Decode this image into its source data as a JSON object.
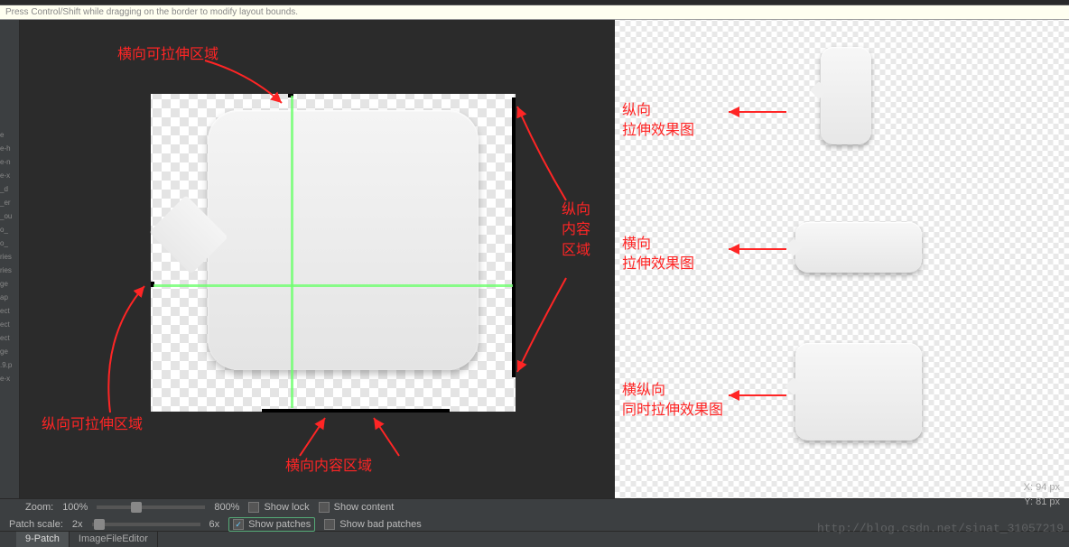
{
  "hint": "Press Control/Shift while dragging on the border to modify layout bounds.",
  "controls": {
    "zoom_label": "Zoom:",
    "zoom_value": "100%",
    "zoom_max": "800%",
    "patch_label": "Patch scale:",
    "patch_min": "2x",
    "patch_max": "6x",
    "show_lock": "Show lock",
    "show_content": "Show content",
    "show_patches": "Show patches",
    "show_bad_patches": "Show bad patches"
  },
  "tabs": {
    "nine_patch": "9-Patch",
    "image_editor": "ImageFileEditor"
  },
  "coords": {
    "x": "X: 94 px",
    "y": "Y: 81 px"
  },
  "annotations": {
    "h_stretch": "横向可拉伸区域",
    "v_stretch": "纵向可拉伸区域",
    "h_content": "横向内容区域",
    "v_content": "纵向\n内容\n区域",
    "pv_v": "纵向\n拉伸效果图",
    "pv_h": "横向\n拉伸效果图",
    "pv_both": "横纵向\n同时拉伸效果图"
  },
  "watermark": "http://blog.csdn.net/sinat_31057219"
}
